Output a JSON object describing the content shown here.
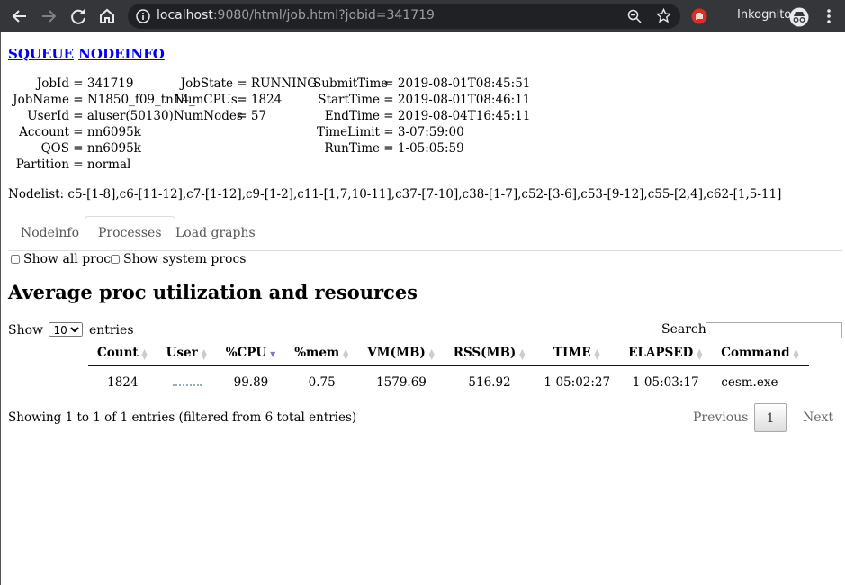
{
  "browser": {
    "url_host": "localhost",
    "url_rest": ":9080/html/job.html?jobid=341719",
    "incognito_label": "Inkognito"
  },
  "nav": {
    "squeue": "SQUEUE",
    "nodeinfo": "NODEINFO"
  },
  "job_info": {
    "col1": [
      {
        "k": "JobId",
        "v": "341719"
      },
      {
        "k": "JobName",
        "v": "N1850_f09_tn14_"
      },
      {
        "k": "UserId",
        "v": "aluser(50130)"
      },
      {
        "k": "Account",
        "v": "nn6095k"
      },
      {
        "k": "QOS",
        "v": "nn6095k"
      },
      {
        "k": "Partition",
        "v": "normal"
      }
    ],
    "col2": [
      {
        "k": "JobState",
        "v": "RUNNING"
      },
      {
        "k": "NumCPUs",
        "v": "1824"
      },
      {
        "k": "NumNodes",
        "v": "57"
      }
    ],
    "col3": [
      {
        "k": "SubmitTime",
        "v": "2019-08-01T08:45:51"
      },
      {
        "k": "StartTime",
        "v": "2019-08-01T08:46:11"
      },
      {
        "k": "EndTime",
        "v": "2019-08-04T16:45:11"
      },
      {
        "k": "TimeLimit",
        "v": "3-07:59:00"
      },
      {
        "k": "RunTime",
        "v": "1-05:05:59"
      }
    ]
  },
  "nodelist": "Nodelist: c5-[1-8],c6-[11-12],c7-[1-12],c9-[1-2],c11-[1,7,10-11],c37-[7-10],c38-[1-7],c52-[3-6],c53-[9-12],c55-[2,4],c62-[1,5-11]",
  "tabs": [
    "Nodeinfo",
    "Processes",
    "Load graphs"
  ],
  "active_tab": "Processes",
  "checkboxes": [
    "Show all procs",
    "Show system procs"
  ],
  "section_title": "Average proc utilization and resources",
  "table_controls": {
    "show_label": "Show",
    "entries_value": "10",
    "entries_label": "entries",
    "search_label": "Search:"
  },
  "table": {
    "headers": [
      "Count",
      "User",
      "%CPU",
      "%mem",
      "VM(MB)",
      "RSS(MB)",
      "TIME",
      "ELAPSED",
      "Command"
    ],
    "sorted_column": "%CPU",
    "rows": [
      [
        "1824",
        "",
        "99.89",
        "0.75",
        "1579.69",
        "516.92",
        "1-05:02:27",
        "1-05:03:17",
        "cesm.exe"
      ]
    ]
  },
  "table_info": "Showing 1 to 1 of 1 entries (filtered from 6 total entries)",
  "pagination": {
    "previous": "Previous",
    "current": "1",
    "next": "Next"
  }
}
